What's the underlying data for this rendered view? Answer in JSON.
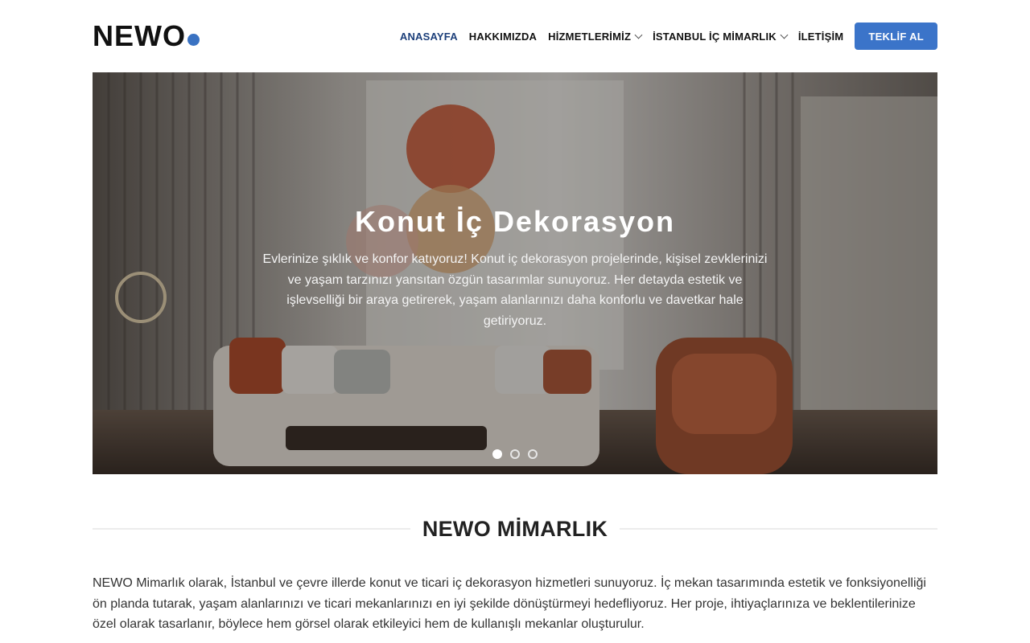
{
  "header": {
    "logo_text": "NEWO",
    "nav": [
      {
        "label": "ANASAYFA",
        "active": true,
        "has_dropdown": false
      },
      {
        "label": "HAKKIMIZDA",
        "active": false,
        "has_dropdown": false
      },
      {
        "label": "HİZMETLERİMİZ",
        "active": false,
        "has_dropdown": true
      },
      {
        "label": "İSTANBUL İÇ MİMARLIK",
        "active": false,
        "has_dropdown": true
      },
      {
        "label": "İLETİŞİM",
        "active": false,
        "has_dropdown": false
      }
    ],
    "cta_label": "TEKLİF AL"
  },
  "hero": {
    "title": "Konut İç Dekorasyon",
    "text": "Evlerinize şıklık ve konfor katıyoruz! Konut iç dekorasyon projelerinde, kişisel zevklerinizi ve yaşam tarzınızı yansıtan özgün tasarımlar sunuyoruz. Her detayda estetik ve işlevselliği bir araya getirerek, yaşam alanlarınızı daha konforlu ve davetkar hale getiriyoruz.",
    "slides_total": 3,
    "active_slide": 1
  },
  "section": {
    "title": "NEWO MİMARLIK",
    "body": "NEWO Mimarlık olarak, İstanbul ve çevre illerde konut ve ticari iç dekorasyon hizmetleri sunuyoruz. İç mekan tasarımında estetik ve fonksiyonelliği ön planda tutarak, yaşam alanlarınızı ve ticari mekanlarınızı en iyi şekilde dönüştürmeyi hedefliyoruz. Her proje, ihtiyaçlarınıza ve beklentilerinize özel olarak tasarlanır, böylece hem görsel olarak etkileyici hem de kullanışlı mekanlar oluşturulur."
  },
  "colors": {
    "accent": "#3b74c9",
    "nav_active": "#1c3f7a",
    "logo_dot": "#3a72c2"
  },
  "icons": {
    "dropdown": "chevron-down-icon"
  }
}
